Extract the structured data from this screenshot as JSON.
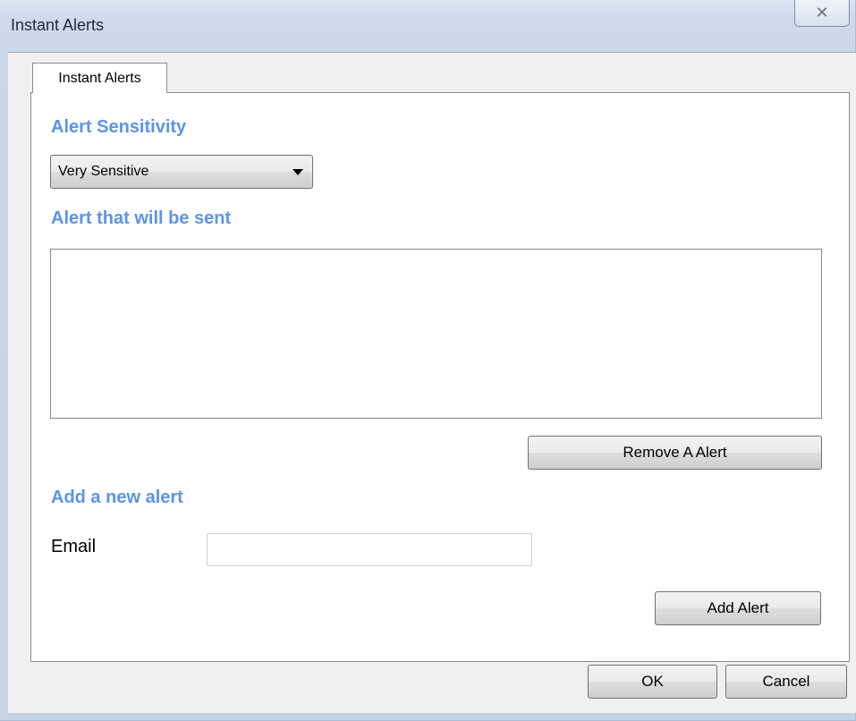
{
  "window": {
    "title": "Instant Alerts",
    "close_glyph": "✕"
  },
  "tabs": [
    {
      "label": "Instant Alerts",
      "selected": true
    }
  ],
  "sensitivity": {
    "heading": "Alert Sensitivity",
    "selected_value": "Very Sensitive"
  },
  "alerts_list": {
    "heading": "Alert that will be sent",
    "items": []
  },
  "remove_button_label": "Remove A Alert",
  "new_alert": {
    "heading": "Add a new alert",
    "email_label": "Email",
    "email_value": "",
    "add_button_label": "Add Alert"
  },
  "footer": {
    "ok_label": "OK",
    "cancel_label": "Cancel"
  },
  "colors": {
    "heading_blue": "#5b94e8",
    "titlebar": "#cddbeb",
    "dialog_background": "#f0f0f0"
  }
}
